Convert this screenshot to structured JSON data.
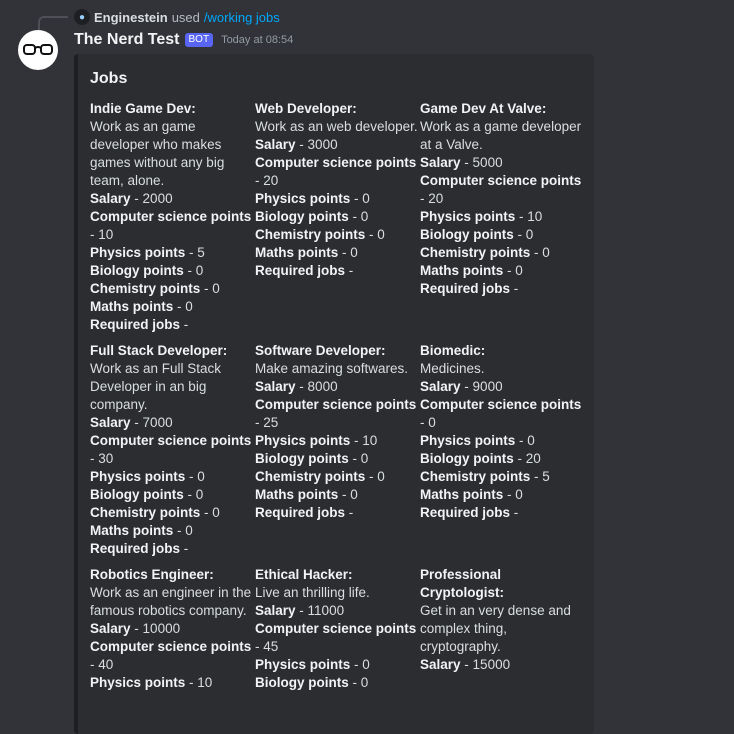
{
  "reply": {
    "user": "Enginestein",
    "used_text": "used",
    "command": "/working jobs"
  },
  "message": {
    "author": "The Nerd Test",
    "bot_tag": "BOT",
    "timestamp": "Today at 08:54"
  },
  "embed": {
    "title": "Jobs",
    "jobs": [
      {
        "name": "Indie Game Dev:",
        "desc": "Work as an game developer who makes games without any big team, alone.",
        "salary": "2000",
        "cs": "10",
        "physics": "5",
        "biology": "0",
        "chemistry": "0",
        "maths": "0",
        "required": "-"
      },
      {
        "name": "Web Developer:",
        "desc": "Work as an web developer.",
        "salary": "3000",
        "cs": "20",
        "physics": "0",
        "biology": "0",
        "chemistry": "0",
        "maths": "0",
        "required": "-"
      },
      {
        "name": "Game Dev At Valve:",
        "desc": "Work as a game developer at a Valve.",
        "salary": "5000",
        "cs": "20",
        "physics": "10",
        "biology": "0",
        "chemistry": "0",
        "maths": "0",
        "required": "-"
      },
      {
        "name": "Full Stack Developer:",
        "desc": "Work as an Full Stack Developer in an big company.",
        "salary": "7000",
        "cs": "30",
        "physics": "0",
        "biology": "0",
        "chemistry": "0",
        "maths": "0",
        "required": "-"
      },
      {
        "name": "Software Developer:",
        "desc": "Make amazing softwares.",
        "salary": "8000",
        "cs": "25",
        "physics": "10",
        "biology": "0",
        "chemistry": "0",
        "maths": "0",
        "required": "-"
      },
      {
        "name": "Biomedic:",
        "desc": "Medicines.",
        "salary": "9000",
        "cs": "0",
        "physics": "0",
        "biology": "20",
        "chemistry": "5",
        "maths": "0",
        "required": "-"
      },
      {
        "name": "Robotics Engineer:",
        "desc": "Work as an engineer in the famous robotics company.",
        "salary": "10000",
        "cs": "40",
        "physics": "10",
        "biology": "",
        "chemistry": "",
        "maths": "",
        "required": ""
      },
      {
        "name": "Ethical Hacker:",
        "desc": "Live an thrilling life.",
        "salary": "11000",
        "cs": "45",
        "physics": "0",
        "biology": "0",
        "chemistry": "",
        "maths": "",
        "required": ""
      },
      {
        "name": "Professional Cryptologist:",
        "desc": "Get in an very dense and complex thing, cryptography.",
        "salary": "15000",
        "cs": "",
        "physics": "",
        "biology": "",
        "chemistry": "",
        "maths": "",
        "required": ""
      }
    ]
  },
  "labels": {
    "salary": "Salary",
    "cs": "Computer science points",
    "physics": "Physics points",
    "biology": "Biology points",
    "chemistry": "Chemistry points",
    "maths": "Maths points",
    "required": "Required jobs"
  }
}
